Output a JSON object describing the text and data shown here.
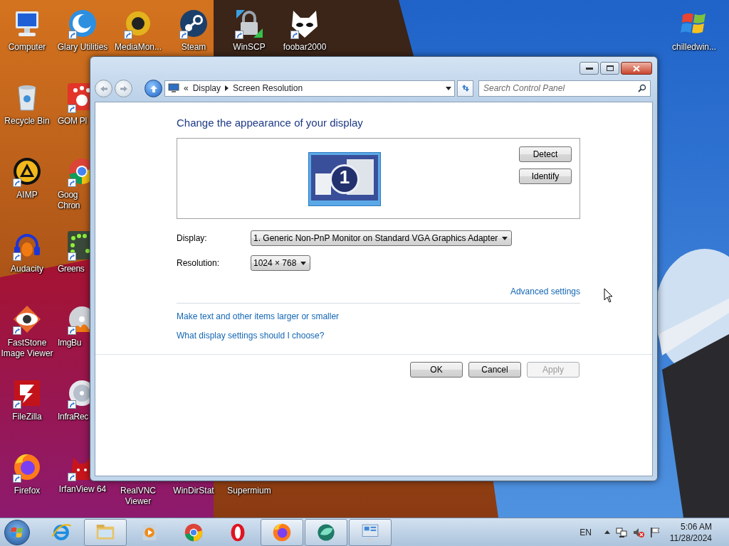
{
  "desktop_icons": [
    {
      "label": "Computer",
      "shortcut": false
    },
    {
      "label": "Glary Utilities",
      "shortcut": true
    },
    {
      "label": "MediaMon...",
      "shortcut": true
    },
    {
      "label": "Steam",
      "shortcut": true
    },
    {
      "label": "WinSCP",
      "shortcut": true
    },
    {
      "label": "foobar2000",
      "shortcut": true
    },
    {
      "label": "chilledwin...",
      "shortcut": false
    },
    {
      "label": "Recycle Bin",
      "shortcut": false
    },
    {
      "label": "GOM Pl",
      "shortcut": true
    },
    {
      "label": "AIMP",
      "shortcut": true
    },
    {
      "label": "Goog\nChron",
      "shortcut": true
    },
    {
      "label": "Audacity",
      "shortcut": true
    },
    {
      "label": "Greens",
      "shortcut": true
    },
    {
      "label": "FastStone Image Viewer",
      "shortcut": true
    },
    {
      "label": "ImgBu",
      "shortcut": true
    },
    {
      "label": "FileZilla",
      "shortcut": true
    },
    {
      "label": "InfraRec",
      "shortcut": true
    },
    {
      "label": "Firefox",
      "shortcut": true
    },
    {
      "label": "IrfanView 64",
      "shortcut": true
    },
    {
      "label": "RealVNC Viewer"
    },
    {
      "label": "WinDirStat"
    },
    {
      "label": "Supermium"
    }
  ],
  "window": {
    "address": {
      "overflow": "«",
      "path": [
        "Display",
        "Screen Resolution"
      ]
    },
    "search": {
      "placeholder": "Search Control Panel"
    },
    "heading": "Change the appearance of your display",
    "monitor": {
      "number": "1"
    },
    "monitor_buttons": [
      "Detect",
      "Identify"
    ],
    "settings": [
      {
        "label": "Display:",
        "value": "1. Generic Non-PnP Monitor on Standard VGA Graphics Adapter"
      },
      {
        "label": "Resolution:",
        "value": "1024 × 768"
      }
    ],
    "advanced_link": "Advanced settings",
    "links": [
      "Make text and other items larger or smaller",
      "What display settings should I choose?"
    ],
    "buttons": [
      {
        "label": "OK",
        "disabled": false
      },
      {
        "label": "Cancel",
        "disabled": false
      },
      {
        "label": "Apply",
        "disabled": true
      }
    ]
  },
  "taskbar": {
    "items": [
      {
        "running": false
      },
      {
        "running": true
      },
      {
        "running": false
      },
      {
        "running": false
      },
      {
        "running": false
      },
      {
        "running": true
      },
      {
        "running": true
      },
      {
        "running": true
      }
    ],
    "language": "EN",
    "time": "5:06 AM",
    "date": "11/28/2024"
  }
}
